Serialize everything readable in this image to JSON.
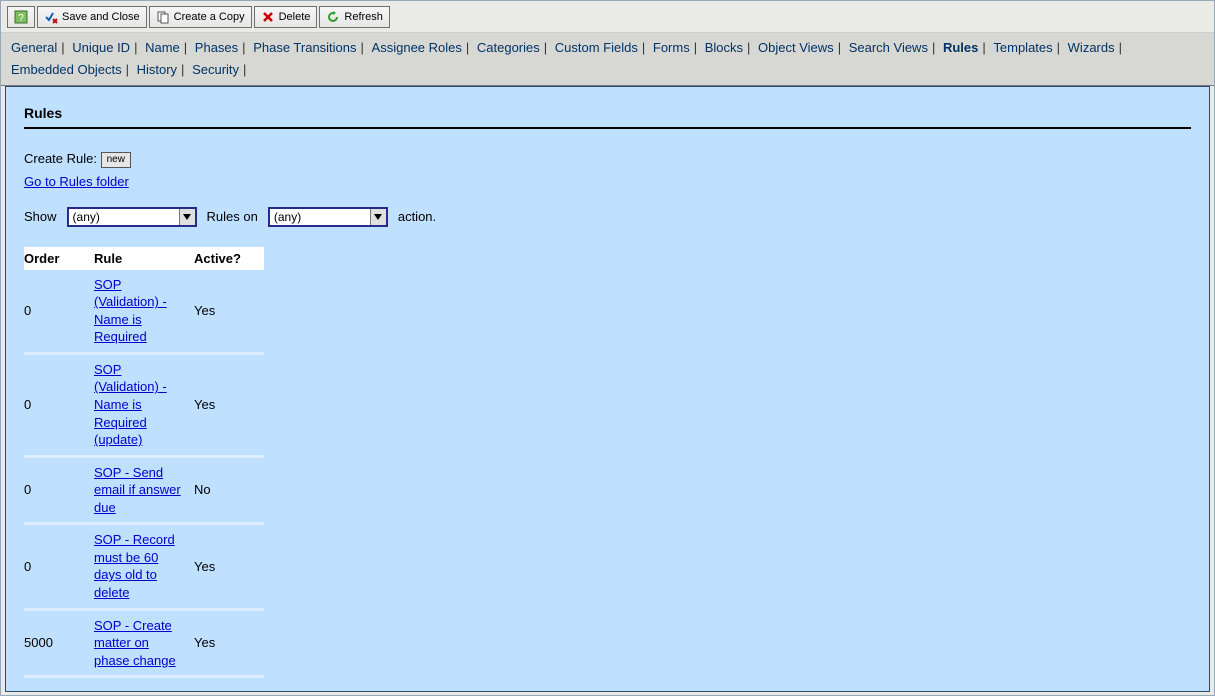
{
  "toolbar": {
    "help": "?",
    "save_close": "Save and Close",
    "create_copy": "Create a Copy",
    "delete": "Delete",
    "refresh": "Refresh"
  },
  "tabs": [
    "General",
    "Unique ID",
    "Name",
    "Phases",
    "Phase Transitions",
    "Assignee Roles",
    "Categories",
    "Custom Fields",
    "Forms",
    "Blocks",
    "Object Views",
    "Search Views",
    "Rules",
    "Templates",
    "Wizards",
    "Embedded Objects",
    "History",
    "Security"
  ],
  "active_tab": "Rules",
  "page_title": "Rules",
  "create_rule_label": "Create Rule:",
  "new_btn": "new",
  "rules_folder_link": "Go to Rules folder",
  "filter": {
    "show_label": "Show",
    "rules_on_label": "Rules on",
    "action_label": "action.",
    "show_value": "(any)",
    "rules_on_value": "(any)"
  },
  "table": {
    "headers": {
      "order": "Order",
      "rule": "Rule",
      "active": "Active?"
    },
    "rows": [
      {
        "order": "0",
        "rule": "SOP (Validation) - Name is Required",
        "active": "Yes"
      },
      {
        "order": "0",
        "rule": "SOP (Validation) - Name is Required (update)",
        "active": "Yes"
      },
      {
        "order": "0",
        "rule": "SOP - Send email if answer due",
        "active": "No"
      },
      {
        "order": "0",
        "rule": "SOP - Record must be 60 days old to delete",
        "active": "Yes"
      },
      {
        "order": "5000",
        "rule": "SOP - Create matter on phase change",
        "active": "Yes"
      }
    ]
  }
}
